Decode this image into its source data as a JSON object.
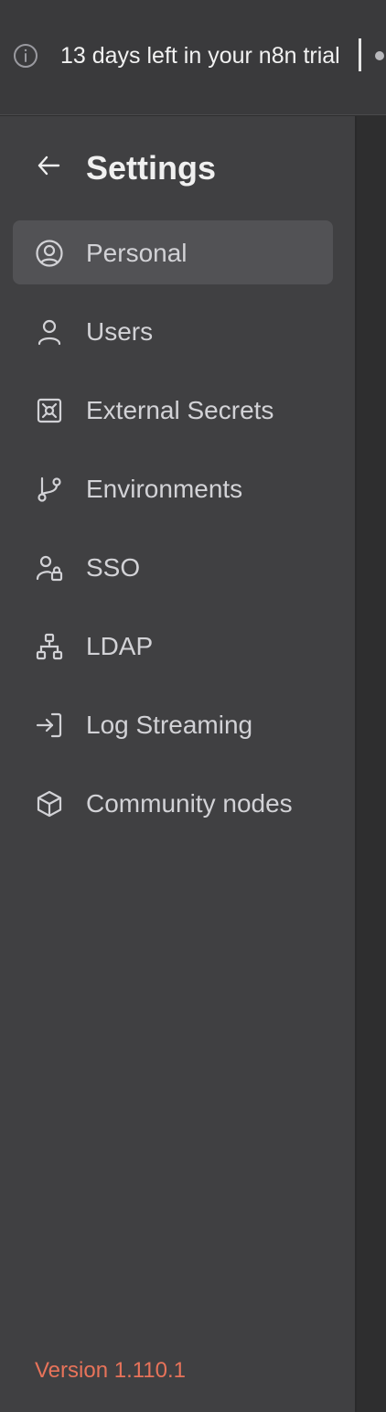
{
  "banner": {
    "text": "13 days left in your n8n trial",
    "icon": "info-icon"
  },
  "sidebar": {
    "back_icon": "arrow-left-icon",
    "title": "Settings",
    "items": [
      {
        "label": "Personal",
        "icon": "user-circle-icon",
        "active": true
      },
      {
        "label": "Users",
        "icon": "user-icon",
        "active": false
      },
      {
        "label": "External Secrets",
        "icon": "vault-icon",
        "active": false
      },
      {
        "label": "Environments",
        "icon": "git-branch-icon",
        "active": false
      },
      {
        "label": "SSO",
        "icon": "user-lock-icon",
        "active": false
      },
      {
        "label": "LDAP",
        "icon": "network-icon",
        "active": false
      },
      {
        "label": "Log Streaming",
        "icon": "log-in-icon",
        "active": false
      },
      {
        "label": "Community nodes",
        "icon": "box-icon",
        "active": false
      }
    ],
    "version": "Version 1.110.1"
  },
  "colors": {
    "accent": "#e8735a",
    "sidebar_bg": "#404042",
    "active_item_bg": "#525255",
    "text": "#d2d2d6"
  }
}
